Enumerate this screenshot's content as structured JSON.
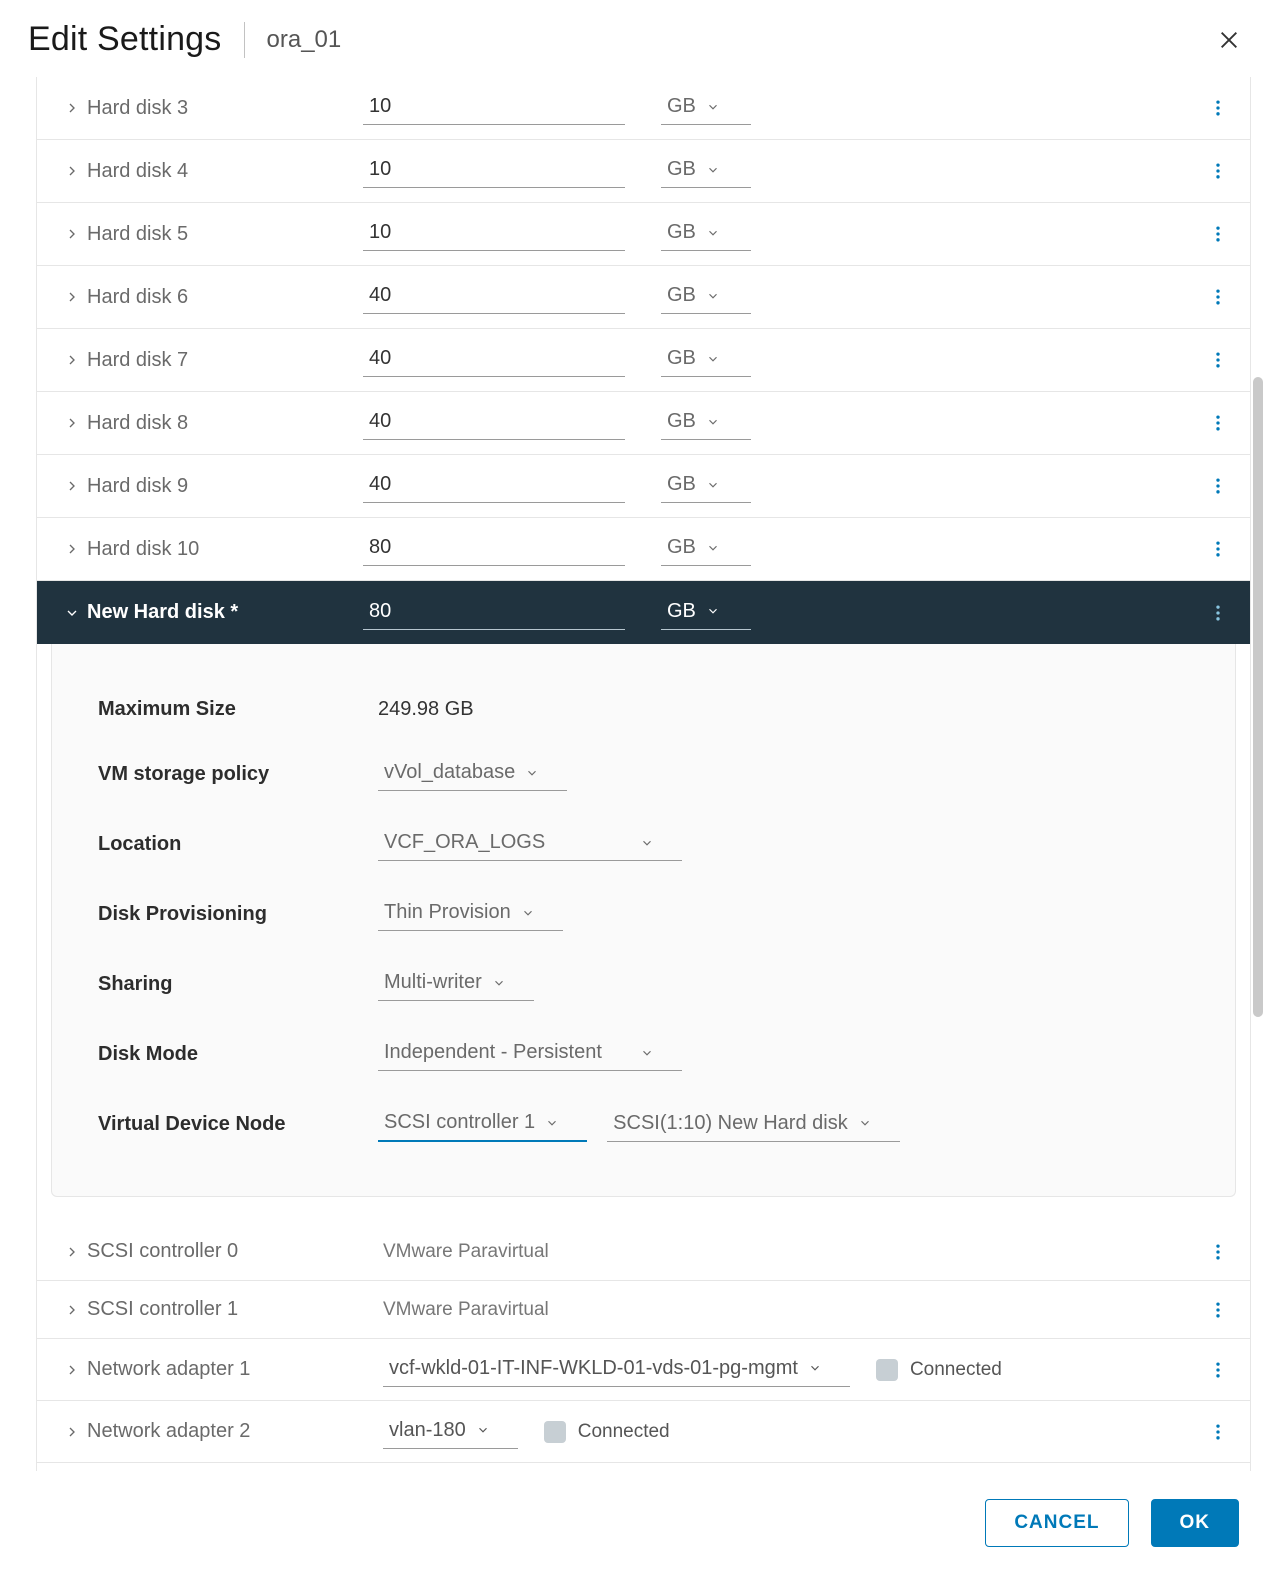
{
  "header": {
    "title": "Edit Settings",
    "vm_name": "ora_01"
  },
  "disks": [
    {
      "label": "Hard disk 3",
      "size": "10",
      "unit": "GB"
    },
    {
      "label": "Hard disk 4",
      "size": "10",
      "unit": "GB"
    },
    {
      "label": "Hard disk 5",
      "size": "10",
      "unit": "GB"
    },
    {
      "label": "Hard disk 6",
      "size": "40",
      "unit": "GB"
    },
    {
      "label": "Hard disk 7",
      "size": "40",
      "unit": "GB"
    },
    {
      "label": "Hard disk 8",
      "size": "40",
      "unit": "GB"
    },
    {
      "label": "Hard disk 9",
      "size": "40",
      "unit": "GB"
    },
    {
      "label": "Hard disk 10",
      "size": "80",
      "unit": "GB"
    }
  ],
  "new_disk": {
    "label": "New Hard disk *",
    "size": "80",
    "unit": "GB",
    "details": {
      "max_size_label": "Maximum Size",
      "max_size_value": "249.98 GB",
      "policy_label": "VM storage policy",
      "policy_value": "vVol_database",
      "location_label": "Location",
      "location_value": "VCF_ORA_LOGS",
      "provisioning_label": "Disk Provisioning",
      "provisioning_value": "Thin Provision",
      "sharing_label": "Sharing",
      "sharing_value": "Multi-writer",
      "disk_mode_label": "Disk Mode",
      "disk_mode_value": "Independent - Persistent",
      "vdn_label": "Virtual Device Node",
      "vdn_controller": "SCSI controller 1",
      "vdn_node": "SCSI(1:10) New Hard disk"
    }
  },
  "scsi": [
    {
      "label": "SCSI controller 0",
      "type": "VMware Paravirtual"
    },
    {
      "label": "SCSI controller 1",
      "type": "VMware Paravirtual"
    }
  ],
  "nics": [
    {
      "label": "Network adapter 1",
      "network": "vcf-wkld-01-IT-INF-WKLD-01-vds-01-pg-mgmt",
      "connected_label": "Connected"
    },
    {
      "label": "Network adapter 2",
      "network": "vlan-180",
      "connected_label": "Connected"
    }
  ],
  "footer": {
    "cancel": "Cancel",
    "ok": "OK"
  }
}
